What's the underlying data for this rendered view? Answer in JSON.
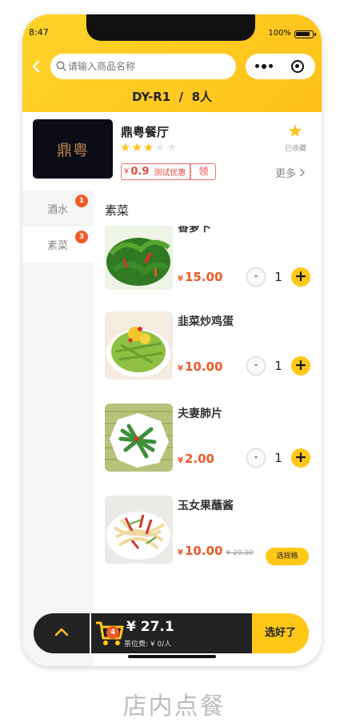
{
  "status_bar": {
    "time": "8:47",
    "battery": "100%"
  },
  "nav": {
    "search_placeholder": "请输入商品名称"
  },
  "table_info": {
    "table": "DY-R1",
    "separator": "/",
    "guests": "8人"
  },
  "shop": {
    "logo_text": "鼎粤",
    "name": "鼎粤餐厅",
    "rating": 3,
    "rating_max": 5,
    "favorite_label": "已收藏",
    "coupon": {
      "currency": "¥",
      "amount": "0.9",
      "label": "测试优惠",
      "claim": "领"
    },
    "more": "更多"
  },
  "categories": [
    {
      "label": "酒水",
      "badge": "1",
      "active": false
    },
    {
      "label": "素菜",
      "badge": "3",
      "active": true
    }
  ],
  "section_title": "素菜",
  "items": [
    {
      "name": "香萝卜",
      "currency": "¥",
      "price": "15.00",
      "quantity": "1",
      "minus": "-",
      "plus": "+"
    },
    {
      "name": "韭菜炒鸡蛋",
      "currency": "¥",
      "price": "10.00",
      "quantity": "1",
      "minus": "-",
      "plus": "+"
    },
    {
      "name": "夫妻肺片",
      "currency": "¥",
      "price": "2.00",
      "quantity": "1",
      "minus": "-",
      "plus": "+"
    },
    {
      "name": "玉女果蘸酱",
      "currency": "¥",
      "price": "10.00",
      "old_price": "¥ 20.00",
      "spec_button": "选规格"
    }
  ],
  "cart": {
    "count": "4",
    "total": "¥ 27.1",
    "tea_fee": "茶位费: ¥ 0/人",
    "checkout": "选好了"
  },
  "page_caption": "店内点餐",
  "colors": {
    "accent": "#ffc817",
    "price": "#f05a28",
    "bar": "#222222"
  }
}
